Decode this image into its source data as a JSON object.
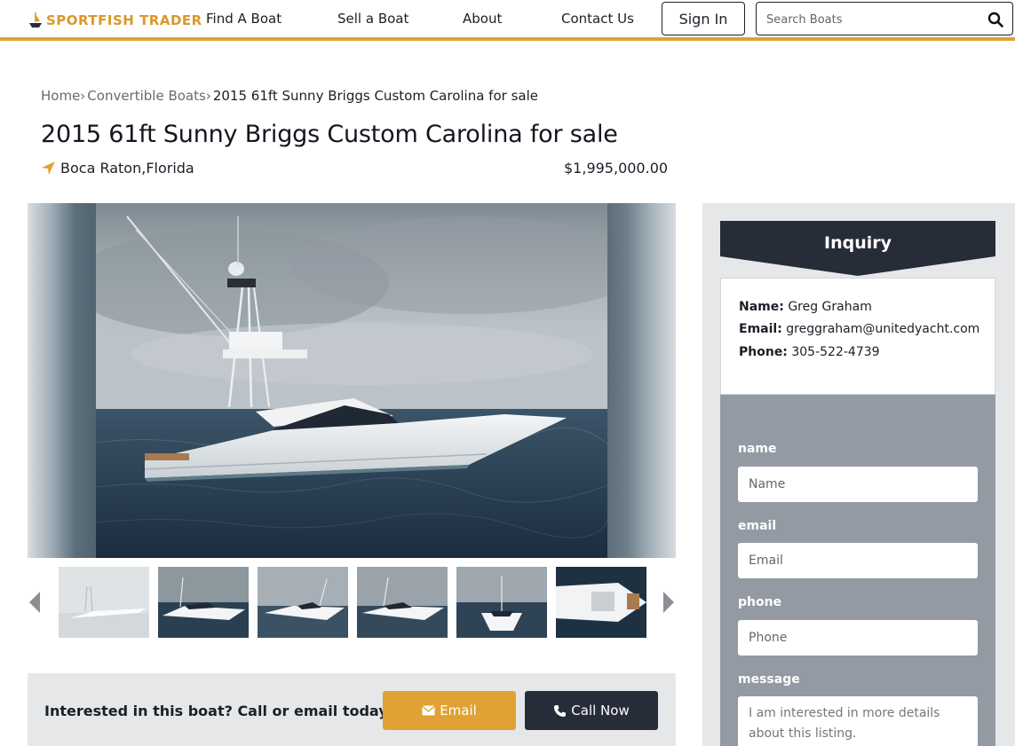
{
  "header": {
    "logo_text": "SPORTFISH TRADER",
    "nav": [
      "Find A Boat",
      "Sell a Boat",
      "About",
      "Contact Us"
    ],
    "signin_label": "Sign In",
    "search_placeholder": "Search Boats"
  },
  "breadcrumb": [
    {
      "label": "Home",
      "sep": "›"
    },
    {
      "label": "Convertible Boats",
      "sep": "›"
    },
    {
      "label": "2015 61ft Sunny Briggs Custom Carolina for sale",
      "sep": ""
    }
  ],
  "listing": {
    "title": "2015 61ft Sunny Briggs Custom Carolina for sale",
    "location": "Boca Raton,Florida",
    "price": "$1,995,000.00"
  },
  "gallery": {
    "thumbnail_count": 6
  },
  "cta": {
    "text": "Interested in this boat? Call or email today!",
    "email_label": "Email",
    "call_label": "Call Now"
  },
  "inquiry": {
    "title": "Inquiry",
    "contact": {
      "name_label": "Name:",
      "name": "Greg Graham",
      "email_label": "Email:",
      "email": "greggraham@unitedyacht.com",
      "phone_label": "Phone:",
      "phone": "305-522-4739"
    },
    "form": {
      "name_label": "name",
      "name_placeholder": "Name",
      "email_label": "email",
      "email_placeholder": "Email",
      "phone_label": "phone",
      "phone_placeholder": "Phone",
      "message_label": "message",
      "message_placeholder": "I am interested in more details about this listing."
    }
  },
  "colors": {
    "accent": "#e0a234",
    "dark": "#262c38",
    "form_bg": "#939aa3",
    "panel_bg": "#e5e7e9"
  }
}
